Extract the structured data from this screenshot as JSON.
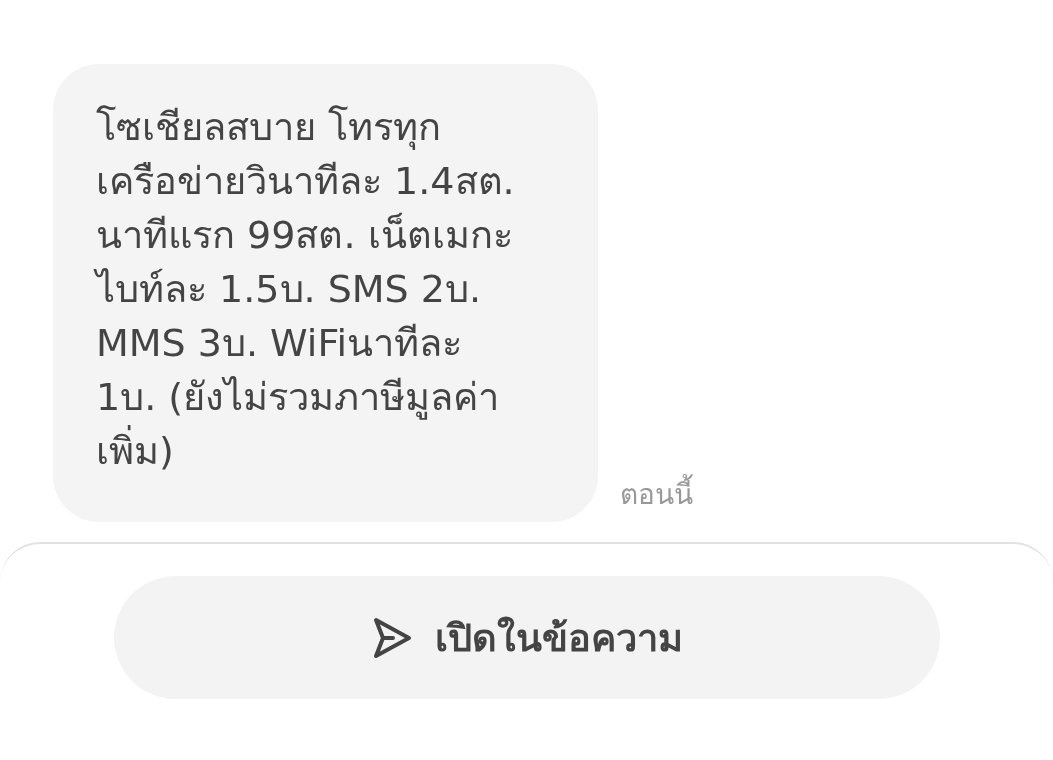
{
  "message": {
    "text": "โซเชียลสบาย โทรทุก\nเครือข่ายวินาทีละ 1.4สต.\nนาทีแรก 99สต. เน็ตเมกะ\nไบท์ละ 1.5บ. SMS 2บ.\nMMS 3บ. WiFiนาทีละ\n1บ. (ยังไม่รวมภาษีมูลค่า\nเพิ่ม)",
    "time": "ตอนนี้"
  },
  "action_button": {
    "label": "เปิดในข้อความ"
  }
}
